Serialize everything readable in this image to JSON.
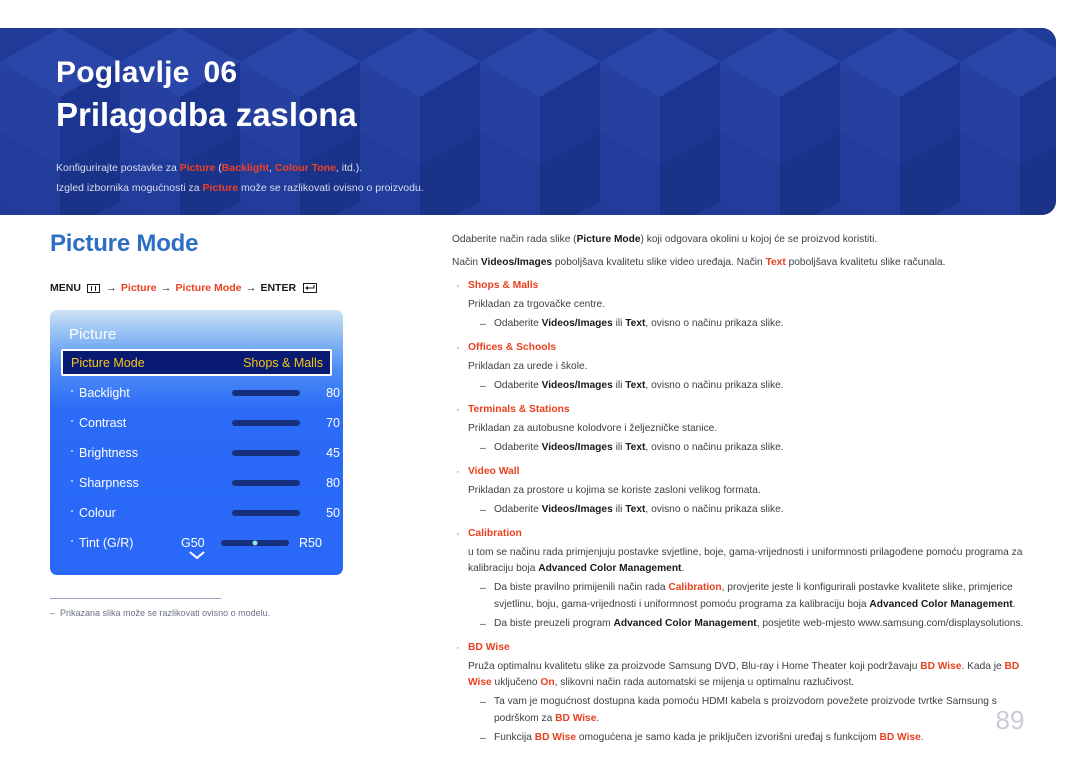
{
  "banner": {
    "chapter_label": "Poglavlje",
    "chapter_number": "06",
    "title": "Prilagodba zaslona",
    "note1_a": "Konfigurirajte postavke za ",
    "note1_picture": "Picture",
    "note1_b": " (",
    "note1_backlight": "Backlight",
    "note1_c": ", ",
    "note1_colourtone": "Colour Tone",
    "note1_d": ", itd.).",
    "note2_a": "Izgled izbornika mogućnosti za ",
    "note2_picture": "Picture",
    "note2_b": " može se razlikovati ovisno o proizvodu."
  },
  "left": {
    "section_title": "Picture Mode",
    "breadcrumb": {
      "menu": "MENU",
      "menu_icon": "menu-bars-icon",
      "arrow": "→",
      "step1": "Picture",
      "step2": "Picture Mode",
      "enter": "ENTER",
      "enter_icon": "enter-key-icon"
    },
    "osd": {
      "header": "Picture",
      "selected": {
        "label": "Picture Mode",
        "value": "Shops & Malls"
      },
      "rows": [
        {
          "label": "Backlight",
          "value": "80",
          "percent": 80
        },
        {
          "label": "Contrast",
          "value": "70",
          "percent": 70
        },
        {
          "label": "Brightness",
          "value": "45",
          "percent": 45
        },
        {
          "label": "Sharpness",
          "value": "80",
          "percent": 80
        },
        {
          "label": "Colour",
          "value": "50",
          "percent": 50
        }
      ],
      "tint": {
        "label": "Tint (G/R)",
        "left": "G50",
        "right": "R50"
      },
      "more_icon": "chevron-down-icon"
    },
    "footnote": {
      "dash": "–",
      "text": "Prikazana slika može se razlikovati ovisno o modelu."
    }
  },
  "right": {
    "intro1_a": "Odaberite način rada slike (",
    "intro1_b": "Picture Mode",
    "intro1_c": ") koji odgovara okolini u kojoj će se proizvod koristiti.",
    "intro2_a": "Način ",
    "intro2_b": "Videos/Images",
    "intro2_c": " poboljšava kvalitetu slike video uređaja. Način ",
    "intro2_d": "Text",
    "intro2_e": " poboljšava kvalitetu slike računala.",
    "sub_common_a": "Odaberite ",
    "sub_common_b": "Videos/Images",
    "sub_common_c": " ili ",
    "sub_common_d": "Text",
    "sub_common_e": ", ovisno o načinu prikaza slike.",
    "items": [
      {
        "title": "Shops & Malls",
        "desc": "Prikladan za trgovačke centre."
      },
      {
        "title": "Offices & Schools",
        "desc": "Prikladan za urede i škole."
      },
      {
        "title": "Terminals & Stations",
        "desc": "Prikladan za autobusne kolodvore i željezničke stanice."
      },
      {
        "title": "Video Wall",
        "desc": "Prikladan za prostore u kojima se koriste zasloni velikog formata."
      }
    ],
    "calibration": {
      "title": "Calibration",
      "desc_a": "u tom se načinu rada primjenjuju postavke svjetline, boje, gama-vrijednosti i uniformnosti prilagođene pomoću programa za kalibraciju boja ",
      "desc_b": "Advanced Color Management",
      "desc_c": ".",
      "sub1_a": "Da biste pravilno primijenili način rada ",
      "sub1_b": "Calibration",
      "sub1_c": ", provjerite jeste li konfigurirali postavke kvalitete slike, primjerice svjetlinu, boju, gama-vrijednosti i uniformnost pomoću programa za kalibraciju boja ",
      "sub1_d": "Advanced Color Management",
      "sub1_e": ".",
      "sub2_a": "Da biste preuzeli program ",
      "sub2_b": "Advanced Color Management",
      "sub2_c": ", posjetite web-mjesto www.samsung.com/displaysolutions."
    },
    "bdwise": {
      "title": "BD Wise",
      "desc_a": "Pruža optimalnu kvalitetu slike za proizvode Samsung DVD, Blu-ray i Home Theater koji podržavaju ",
      "desc_b": "BD Wise",
      "desc_c": ". Kada je ",
      "desc_d": "BD Wise",
      "desc_e": " uključeno ",
      "desc_f": "On",
      "desc_g": ", slikovni način rada automatski se mijenja u optimalnu razlučivost.",
      "sub1_a": "Ta vam je mogućnost dostupna kada pomoću HDMI kabela s proizvodom povežete proizvode tvrtke Samsung s podrškom za ",
      "sub1_b": "BD Wise",
      "sub1_c": ".",
      "sub2_a": "Funkcija ",
      "sub2_b": "BD Wise",
      "sub2_c": " omogućena je samo kada je priključen izvorišni uređaj s funkcijom ",
      "sub2_d": "BD Wise",
      "sub2_e": "."
    }
  },
  "page_number": "89",
  "colors": {
    "banner_blue": "#1f3a97",
    "accent_red": "#e8411f",
    "section_blue": "#2e6fc4",
    "osd_blue": "#2a68f8",
    "osd_selected": "#091a72",
    "osd_yellow": "#f5c518",
    "slider_fill": "#8fe8dc",
    "page_num_grey": "#c9ccd6"
  }
}
